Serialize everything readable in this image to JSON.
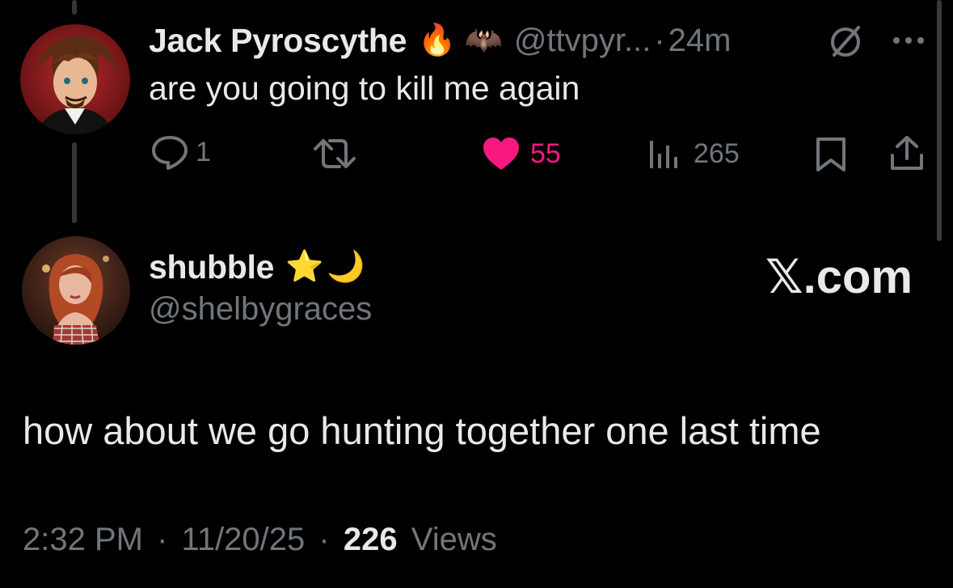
{
  "reply_tweet": {
    "author_name": "Jack Pyroscythe",
    "emoji_1": "🔥",
    "emoji_2": "🦇",
    "handle": "@ttvpyr...",
    "separator": "·",
    "time_ago": "24m",
    "text": "are you going to kill me again",
    "actions": {
      "reply_count": "1",
      "like_count": "55",
      "views_count": "265"
    },
    "like_color": "#f91880"
  },
  "main_tweet": {
    "author_name": "shubble",
    "emoji_1": "⭐",
    "emoji_2": "🌙",
    "handle": "@shelbygraces",
    "text": "how about we go hunting together one last time",
    "time": "2:32 PM",
    "separator": "·",
    "date": "11/20/25",
    "views_number": "226",
    "views_label": "Views"
  },
  "brand": {
    "x_glyph": "𝕏",
    "domain": ".com"
  },
  "colors": {
    "background": "#000000",
    "text": "#e7e9ea",
    "muted": "#71767b",
    "like": "#f91880"
  }
}
